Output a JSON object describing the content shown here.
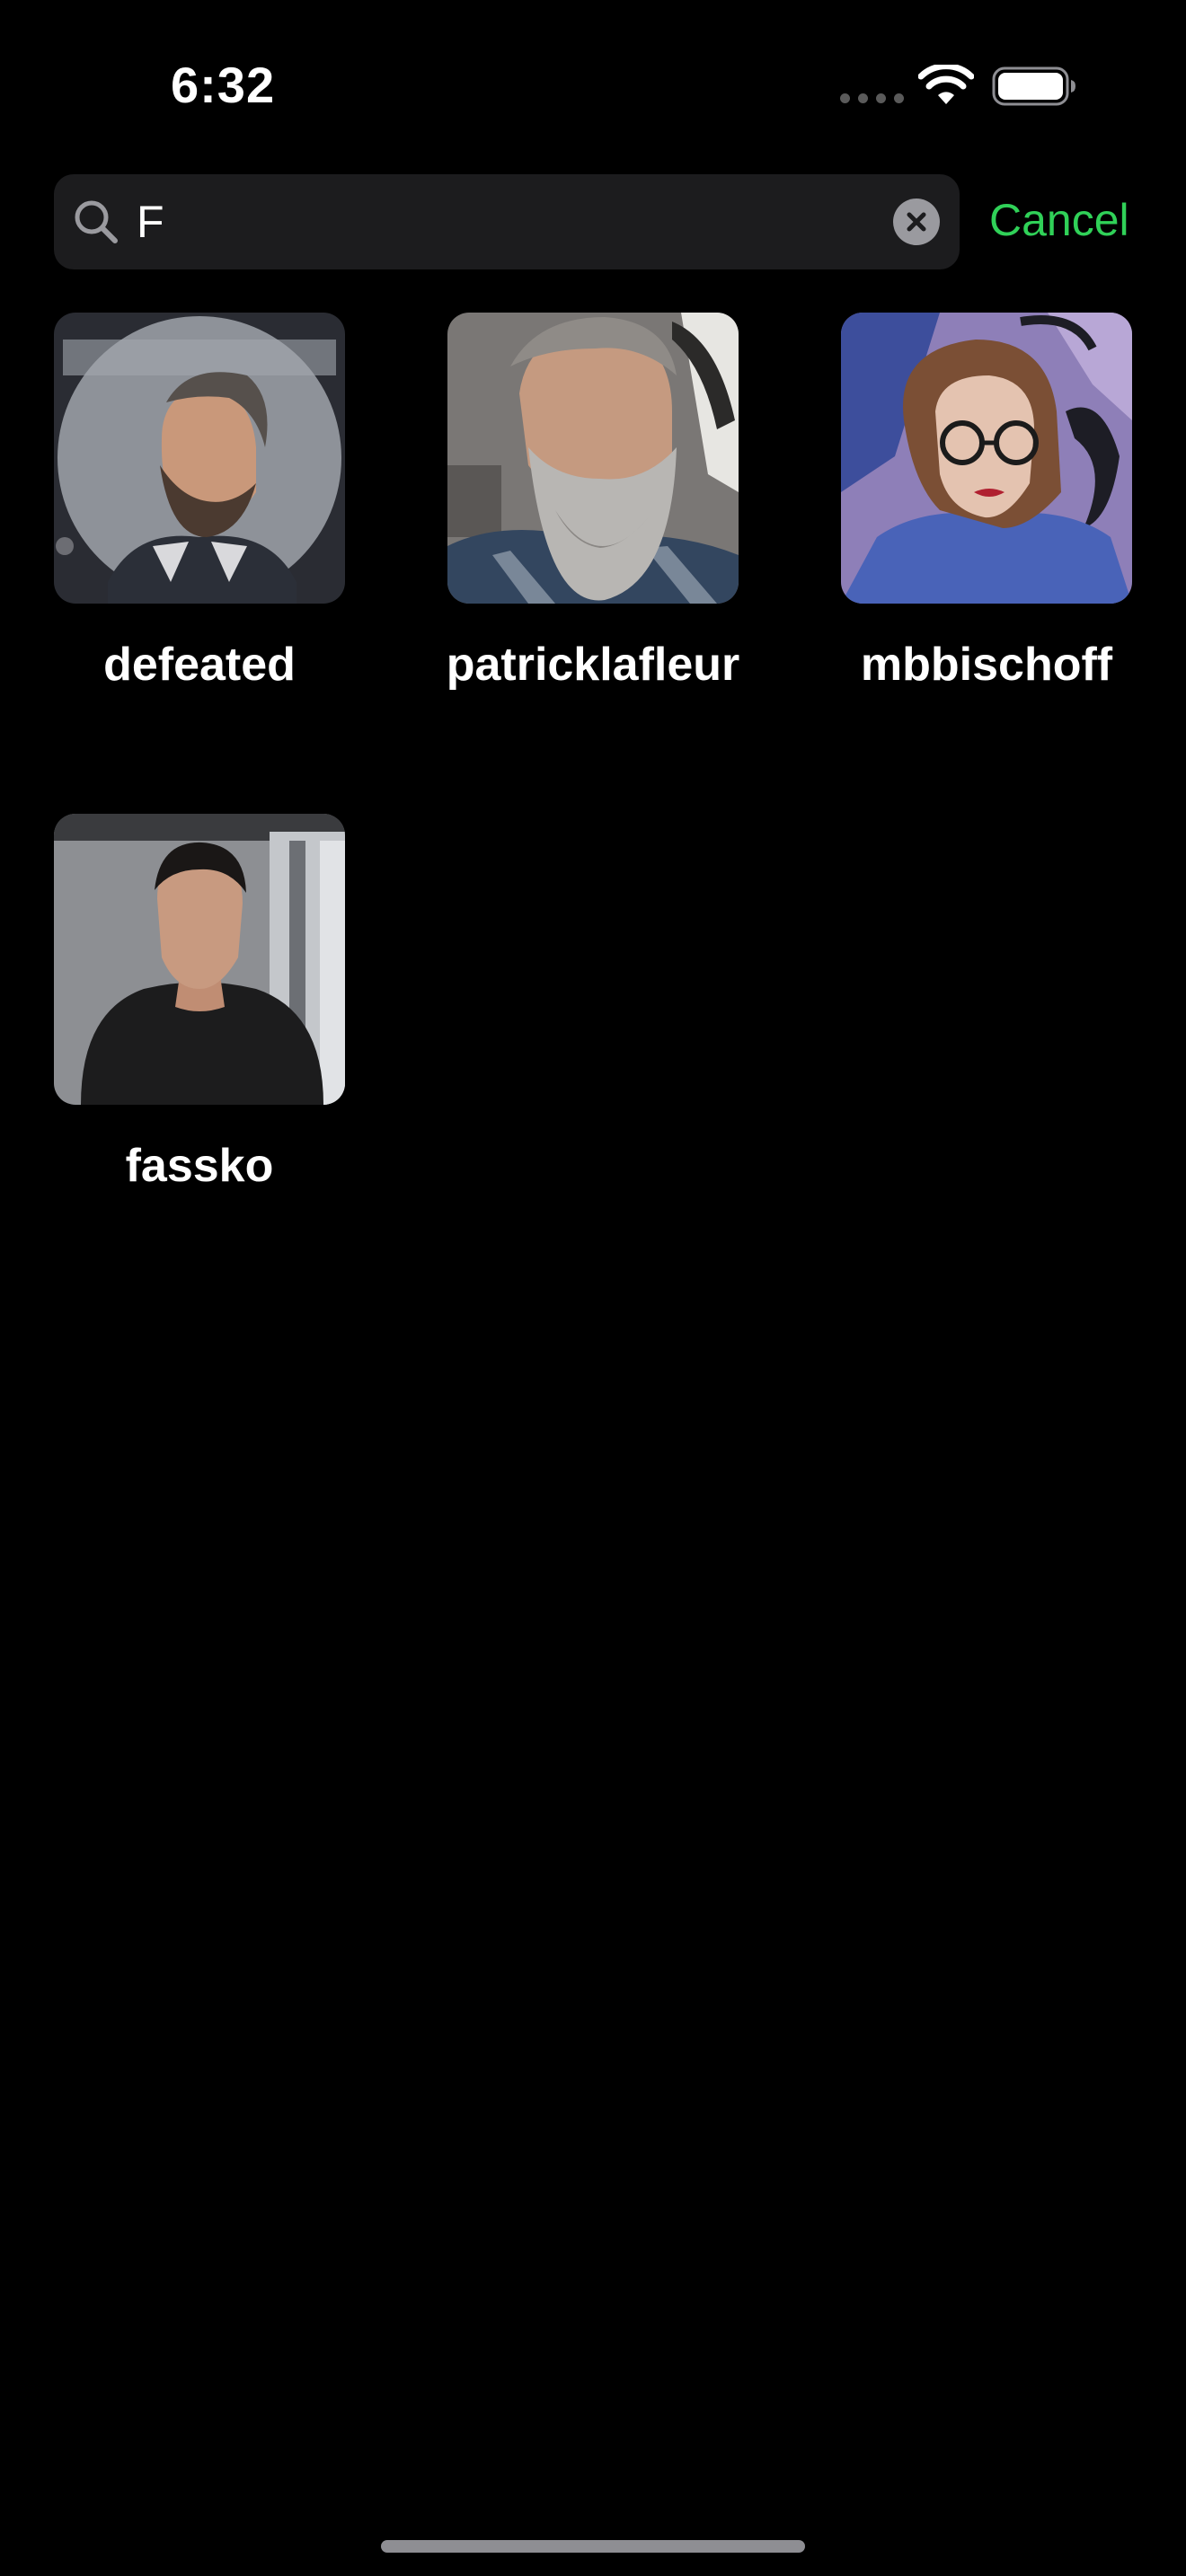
{
  "status_bar": {
    "time": "6:32"
  },
  "search": {
    "value": "F",
    "cancel_label": "Cancel",
    "accent_color": "#30d158"
  },
  "results": [
    {
      "username": "defeated",
      "avatar": "bearded-man-round-avatar"
    },
    {
      "username": "patricklafleur",
      "avatar": "gray-bearded-man-in-car"
    },
    {
      "username": "mbbischoff",
      "avatar": "woman-with-glasses"
    },
    {
      "username": "fassko",
      "avatar": "man-in-black-shirt"
    }
  ]
}
